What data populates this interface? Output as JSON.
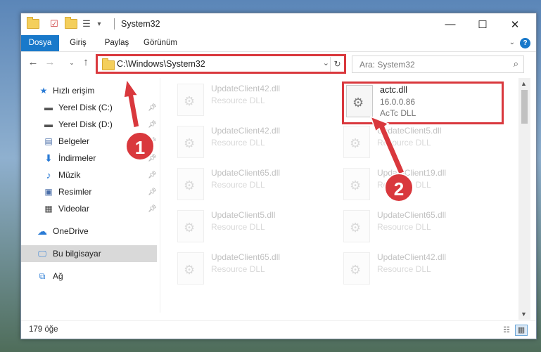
{
  "window": {
    "title": "System32",
    "controls": {
      "minimize": "—",
      "maximize": "☐",
      "close": "✕"
    }
  },
  "ribbon": {
    "tabs": [
      {
        "label": "Dosya",
        "active": true
      },
      {
        "label": "Giriş"
      },
      {
        "label": "Paylaş"
      },
      {
        "label": "Görünüm"
      }
    ],
    "help": "?"
  },
  "address": {
    "path": "C:\\Windows\\System32",
    "search_placeholder": "Ara: System32"
  },
  "sidebar": {
    "items": [
      {
        "label": "Hızlı erişim",
        "icon": "star-icon"
      },
      {
        "label": "Yerel Disk (C:)",
        "icon": "drive-icon",
        "pinned": true
      },
      {
        "label": "Yerel Disk (D:)",
        "icon": "drive-icon",
        "pinned": true
      },
      {
        "label": "Belgeler",
        "icon": "documents-icon",
        "pinned": true
      },
      {
        "label": "İndirmeler",
        "icon": "download-icon",
        "pinned": true
      },
      {
        "label": "Müzik",
        "icon": "music-icon",
        "pinned": true
      },
      {
        "label": "Resimler",
        "icon": "pictures-icon",
        "pinned": true
      },
      {
        "label": "Videolar",
        "icon": "videos-icon",
        "pinned": true
      },
      {
        "label": "OneDrive",
        "icon": "cloud-icon"
      },
      {
        "label": "Bu bilgisayar",
        "icon": "computer-icon",
        "selected": true
      },
      {
        "label": "Ağ",
        "icon": "network-icon"
      }
    ]
  },
  "files": {
    "highlighted": {
      "name": "actc.dll",
      "version": "16.0.0.86",
      "description": "AcTc DLL"
    },
    "background": [
      {
        "name": "UpdateClient42.dll",
        "desc": "Resource DLL"
      },
      {
        "name": "UpdateClient42.dll",
        "desc": "Resource DLL"
      },
      {
        "name": "UpdateClient5.dll",
        "desc": "Resource DLL"
      },
      {
        "name": "UpdateClient65.dll",
        "desc": "Resource DLL"
      },
      {
        "name": "UpdateClient19.dll",
        "desc": "Resource DLL"
      },
      {
        "name": "UpdateClient5.dll",
        "desc": "Resource DLL"
      },
      {
        "name": "UpdateClient65.dll",
        "desc": "Resource DLL"
      },
      {
        "name": "UpdateClient65.dll",
        "desc": "Resource DLL"
      },
      {
        "name": "UpdateClient42.dll",
        "desc": "Resource DLL"
      }
    ]
  },
  "status": {
    "item_count": "179 öğe"
  },
  "callouts": {
    "step1": "1",
    "step2": "2"
  },
  "colors": {
    "accent": "#1979ca",
    "highlight": "#d9383d"
  }
}
